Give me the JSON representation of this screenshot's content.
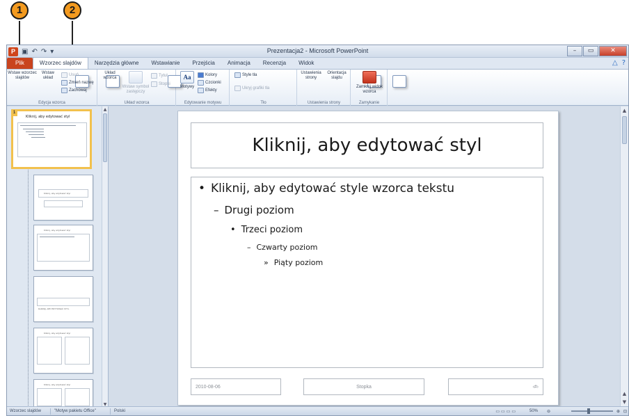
{
  "callouts": {
    "one": "1",
    "two": "2"
  },
  "window": {
    "title": "Prezentacja2 - Microsoft PowerPoint",
    "app_logo": "P",
    "qat": {
      "save": "▣",
      "undo": "↶",
      "redo": "↷",
      "customize": "▾"
    },
    "controls": {
      "minimize": "–",
      "maximize": "▭",
      "close": "✕"
    }
  },
  "tabs": {
    "file": "Plik",
    "items": [
      "Wzorzec slajdów",
      "Narzędzia główne",
      "Wstawianie",
      "Przejścia",
      "Animacja",
      "Recenzja",
      "Widok"
    ],
    "help_icons": [
      "△",
      "?"
    ]
  },
  "ribbon": {
    "edycja_wzorca": {
      "label": "Edycja wzorca",
      "insert_master": "Wstaw wzorzec slajdów",
      "insert_layout": "Wstaw układ",
      "delete": "Usuń",
      "rename": "Zmień nazwę",
      "preserve": "Zachowaj"
    },
    "uklad_wzorca": {
      "label": "Układ wzorca",
      "master_layout": "Układ wzorca",
      "insert_placeholder": "Wstaw symbol zastępczy",
      "title": "Tytuł",
      "footers": "Stopki"
    },
    "edytowanie_motywu": {
      "label": "Edytowanie motywu",
      "themes": "Motywy",
      "colors": "Kolory",
      "fonts": "Czcionki",
      "effects": "Efekty"
    },
    "tlo": {
      "label": "Tło",
      "background_styles": "Style tła",
      "hide_graphics": "Ukryj grafiki tła"
    },
    "ustawienia_strony": {
      "label": "Ustawienia strony",
      "page_setup": "Ustawienia strony",
      "orientation": "Orientacja slajdu"
    },
    "zamykanie": {
      "label": "Zamykanie",
      "close_master": "Zamknij widok wzorca"
    }
  },
  "thumbs": {
    "master_num": "1",
    "master_title": "Kliknij, aby edytować styl",
    "layout_title": "Kliknij, aby edytować styl",
    "section_title": "KLIKNIJ, ABY EDYTOWAĆ STYL"
  },
  "slide": {
    "title": "Kliknij, aby edytować styl",
    "levels": [
      "Kliknij, aby edytować style wzorca tekstu",
      "Drugi poziom",
      "Trzeci poziom",
      "Czwarty poziom",
      "Piąty poziom"
    ],
    "bullets": [
      "•",
      "–",
      "•",
      "–",
      "»"
    ],
    "footer_date": "2010-08-06",
    "footer_text": "Stopka",
    "footer_num": "‹#›"
  },
  "statusbar": {
    "view": "Wzorzec slajdów",
    "theme": "\"Motyw pakietu Office\"",
    "language": "Polski",
    "zoom": "50%"
  }
}
